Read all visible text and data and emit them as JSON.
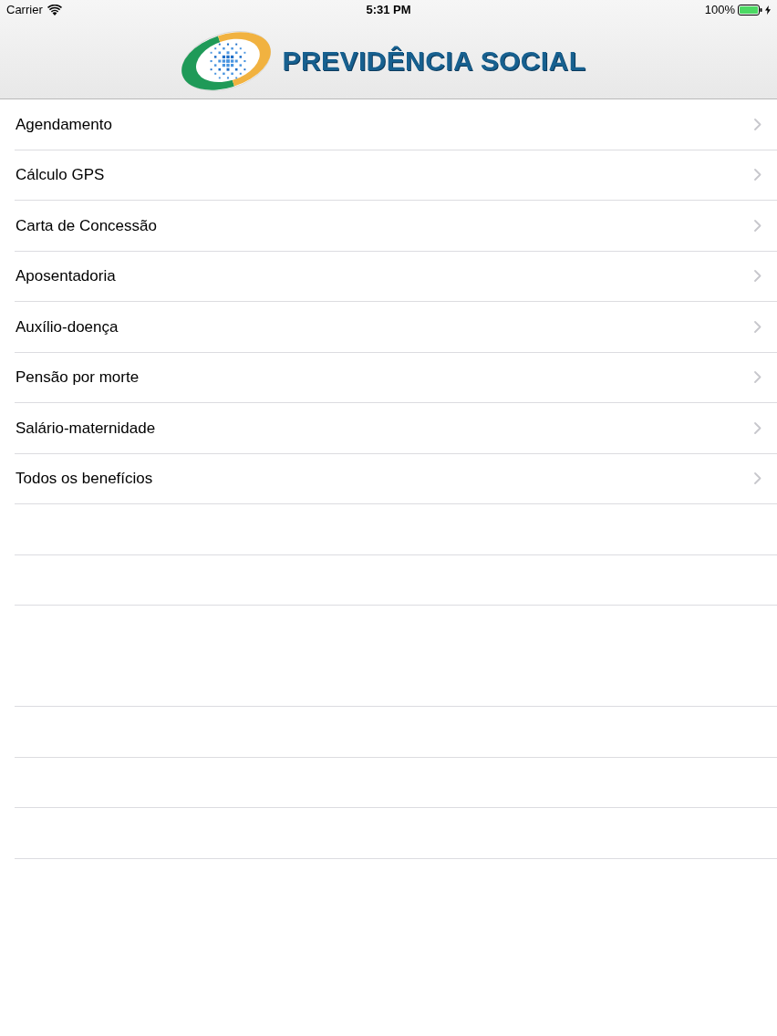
{
  "status_bar": {
    "carrier": "Carrier",
    "time": "5:31 PM",
    "battery": "100%"
  },
  "header": {
    "logo_text": "PREVIDÊNCIA SOCIAL"
  },
  "menu": {
    "items": [
      {
        "label": "Agendamento"
      },
      {
        "label": "Cálculo GPS"
      },
      {
        "label": "Carta de Concessão"
      },
      {
        "label": "Aposentadoria"
      },
      {
        "label": "Auxílio-doença"
      },
      {
        "label": "Pensão por morte"
      },
      {
        "label": "Salário-maternidade"
      },
      {
        "label": "Todos os benefícios"
      }
    ]
  }
}
